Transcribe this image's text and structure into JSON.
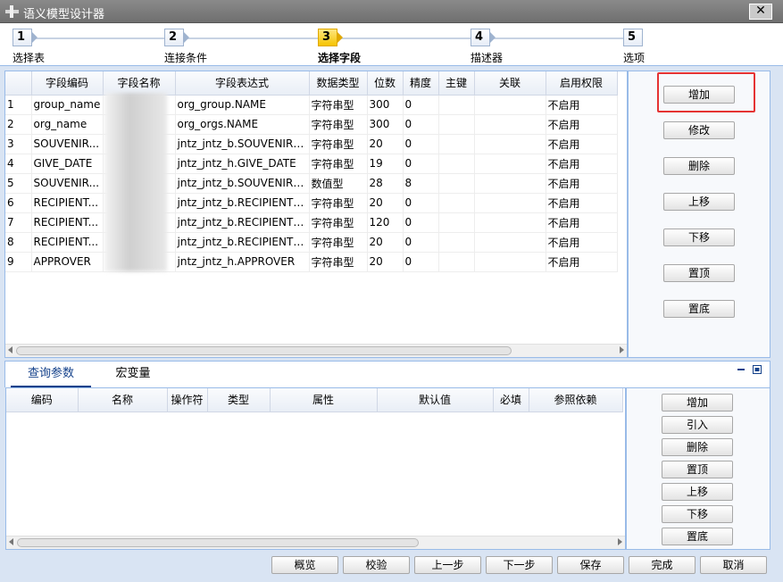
{
  "window": {
    "title": "语义模型设计器",
    "close_glyph": "✕"
  },
  "steps": [
    {
      "num": "1",
      "label": "选择表",
      "active": false
    },
    {
      "num": "2",
      "label": "连接条件",
      "active": false
    },
    {
      "num": "3",
      "label": "选择字段",
      "active": true
    },
    {
      "num": "4",
      "label": "描述器",
      "active": false
    },
    {
      "num": "5",
      "label": "选项",
      "active": false
    }
  ],
  "fields_grid": {
    "columns": [
      "",
      "字段编码",
      "字段名称",
      "字段表达式",
      "数据类型",
      "位数",
      "精度",
      "主键",
      "关联",
      "启用权限"
    ],
    "rows": [
      [
        "1",
        "group_name",
        "",
        "org_group.NAME",
        "字符串型",
        "300",
        "0",
        "",
        "",
        "不启用"
      ],
      [
        "2",
        "org_name",
        "",
        "org_orgs.NAME",
        "字符串型",
        "300",
        "0",
        "",
        "",
        "不启用"
      ],
      [
        "3",
        "SOUVENIR...",
        "",
        "jntz_jntz_b.SOUVENIR_N...",
        "字符串型",
        "20",
        "0",
        "",
        "",
        "不启用"
      ],
      [
        "4",
        "GIVE_DATE",
        "",
        "jntz_jntz_h.GIVE_DATE",
        "字符串型",
        "19",
        "0",
        "",
        "",
        "不启用"
      ],
      [
        "5",
        "SOUVENIR...",
        "",
        "jntz_jntz_b.SOUVENIR_C...",
        "数值型",
        "28",
        "8",
        "",
        "",
        "不启用"
      ],
      [
        "6",
        "RECIPIENT...",
        "",
        "jntz_jntz_b.RECIPIENT_...",
        "字符串型",
        "20",
        "0",
        "",
        "",
        "不启用"
      ],
      [
        "7",
        "RECIPIENT...",
        "",
        "jntz_jntz_b.RECIPIENT_...",
        "字符串型",
        "120",
        "0",
        "",
        "",
        "不启用"
      ],
      [
        "8",
        "RECIPIENT...",
        "",
        "jntz_jntz_b.RECIPIENT_...",
        "字符串型",
        "20",
        "0",
        "",
        "",
        "不启用"
      ],
      [
        "9",
        "APPROVER",
        "",
        "jntz_jntz_h.APPROVER",
        "字符串型",
        "20",
        "0",
        "",
        "",
        "不启用"
      ]
    ]
  },
  "field_buttons": [
    "增加",
    "修改",
    "删除",
    "上移",
    "下移",
    "置顶",
    "置底"
  ],
  "bottom_tabs": [
    "查询参数",
    "宏变量"
  ],
  "params_grid": {
    "columns": [
      "编码",
      "名称",
      "操作符",
      "类型",
      "属性",
      "默认值",
      "必填",
      "参照依赖"
    ],
    "rows": []
  },
  "param_buttons": [
    "增加",
    "引入",
    "删除",
    "置顶",
    "上移",
    "下移",
    "置底"
  ],
  "footer_buttons": [
    "概览",
    "校验",
    "上一步",
    "下一步",
    "保存",
    "完成",
    "取消"
  ]
}
